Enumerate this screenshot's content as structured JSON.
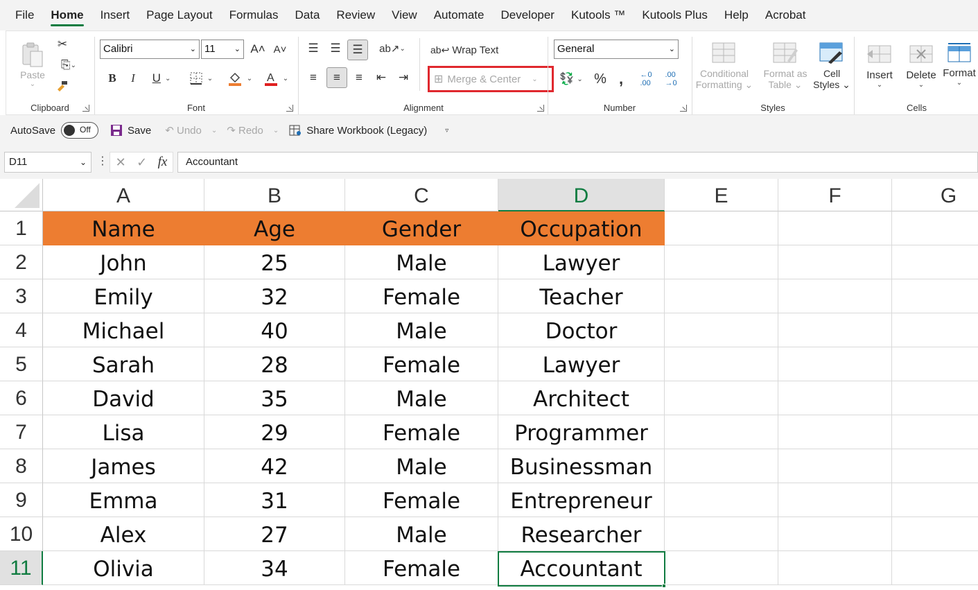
{
  "menu": {
    "tabs": [
      "File",
      "Home",
      "Insert",
      "Page Layout",
      "Formulas",
      "Data",
      "Review",
      "View",
      "Automate",
      "Developer",
      "Kutools ™",
      "Kutools Plus",
      "Help",
      "Acrobat"
    ],
    "active_tab": "Home"
  },
  "ribbon": {
    "clipboard": {
      "label": "Clipboard",
      "paste": "Paste"
    },
    "font": {
      "label": "Font",
      "font_name": "Calibri",
      "font_size": "11"
    },
    "alignment": {
      "label": "Alignment",
      "wrap_text": "Wrap Text",
      "merge_center": "Merge & Center"
    },
    "number": {
      "label": "Number",
      "format": "General"
    },
    "styles": {
      "label": "Styles",
      "conditional_formatting": [
        "Conditional",
        "Formatting"
      ],
      "format_as_table": [
        "Format as",
        "Table"
      ],
      "cell_styles": [
        "Cell",
        "Styles"
      ]
    },
    "cells": {
      "label": "Cells",
      "insert": "Insert",
      "delete": "Delete",
      "format": "Format"
    }
  },
  "qat": {
    "autosave": "AutoSave",
    "autosave_state": "Off",
    "save": "Save",
    "undo": "Undo",
    "redo": "Redo",
    "share": "Share Workbook (Legacy)"
  },
  "formula_bar": {
    "name_box": "D11",
    "value": "Accountant"
  },
  "sheet": {
    "columns": [
      "A",
      "B",
      "C",
      "D",
      "E",
      "F",
      "G"
    ],
    "selected_column": "D",
    "selected_row": "11",
    "rows": [
      {
        "n": "1",
        "cells": [
          "Name",
          "Age",
          "Gender",
          "Occupation"
        ]
      },
      {
        "n": "2",
        "cells": [
          "John",
          "25",
          "Male",
          "Lawyer"
        ]
      },
      {
        "n": "3",
        "cells": [
          "Emily",
          "32",
          "Female",
          "Teacher"
        ]
      },
      {
        "n": "4",
        "cells": [
          "Michael",
          "40",
          "Male",
          "Doctor"
        ]
      },
      {
        "n": "5",
        "cells": [
          "Sarah",
          "28",
          "Female",
          "Lawyer"
        ]
      },
      {
        "n": "6",
        "cells": [
          "David",
          "35",
          "Male",
          "Architect"
        ]
      },
      {
        "n": "7",
        "cells": [
          "Lisa",
          "29",
          "Female",
          "Programmer"
        ]
      },
      {
        "n": "8",
        "cells": [
          "James",
          "42",
          "Male",
          "Businessman"
        ]
      },
      {
        "n": "9",
        "cells": [
          "Emma",
          "31",
          "Female",
          "Entrepreneur"
        ]
      },
      {
        "n": "10",
        "cells": [
          "Alex",
          "27",
          "Male",
          "Researcher"
        ]
      },
      {
        "n": "11",
        "cells": [
          "Olivia",
          "34",
          "Female",
          "Accountant"
        ]
      }
    ]
  },
  "colors": {
    "accent": "#107c41",
    "header_fill": "#ed7d31",
    "highlight_box": "#e0282e"
  }
}
